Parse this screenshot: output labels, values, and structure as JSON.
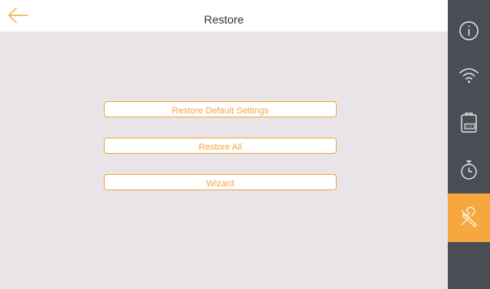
{
  "header": {
    "title": "Restore",
    "back_icon": "arrow-left-icon"
  },
  "actions": [
    {
      "label": "Restore Default Settings"
    },
    {
      "label": "Restore All"
    },
    {
      "label": "Wizard"
    }
  ],
  "sidebar": {
    "items": [
      {
        "icon": "info-icon",
        "active": false
      },
      {
        "icon": "wifi-icon",
        "active": false
      },
      {
        "icon": "device-icon",
        "active": false
      },
      {
        "icon": "timer-icon",
        "active": false
      },
      {
        "icon": "tools-icon",
        "active": true
      }
    ]
  },
  "colors": {
    "accent": "#f6a83f",
    "sidebar_bg": "#4a4d55",
    "content_bg": "#e8e4e7",
    "header_bg": "#ffffff"
  }
}
